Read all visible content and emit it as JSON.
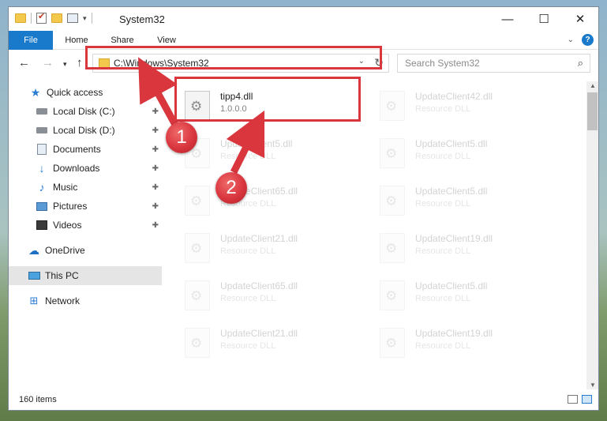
{
  "window": {
    "title": "System32",
    "controls": {
      "minimize": "—",
      "maximize": "☐",
      "close": "✕"
    }
  },
  "ribbon": {
    "tabs": [
      "File",
      "Home",
      "Share",
      "View"
    ],
    "help": "?"
  },
  "navbar": {
    "address": "C:\\Windows\\System32",
    "search_placeholder": "Search System32"
  },
  "sidebar": {
    "items": [
      {
        "label": "Quick access",
        "icon": "star-icon"
      },
      {
        "label": "Local Disk (C:)",
        "icon": "drive-icon",
        "pinned": true
      },
      {
        "label": "Local Disk (D:)",
        "icon": "drive-icon",
        "pinned": true
      },
      {
        "label": "Documents",
        "icon": "documents-icon",
        "pinned": true
      },
      {
        "label": "Downloads",
        "icon": "download-icon",
        "pinned": true
      },
      {
        "label": "Music",
        "icon": "music-icon",
        "pinned": true
      },
      {
        "label": "Pictures",
        "icon": "pictures-icon",
        "pinned": true
      },
      {
        "label": "Videos",
        "icon": "videos-icon",
        "pinned": true
      },
      {
        "label": "OneDrive",
        "icon": "cloud-icon"
      },
      {
        "label": "This PC",
        "icon": "computer-icon",
        "selected": true
      },
      {
        "label": "Network",
        "icon": "network-icon"
      }
    ]
  },
  "files": [
    {
      "name": "tipp4.dll",
      "subtitle": "1.0.0.0"
    },
    {
      "name": "UpdateClient42.dll",
      "subtitle": "Resource DLL"
    },
    {
      "name": "UpdateClient5.dll",
      "subtitle": "Resource DLL"
    },
    {
      "name": "UpdateClient5.dll",
      "subtitle": "Resource DLL"
    },
    {
      "name": "UpdateClient65.dll",
      "subtitle": "Resource DLL"
    },
    {
      "name": "UpdateClient5.dll",
      "subtitle": "Resource DLL"
    },
    {
      "name": "UpdateClient21.dll",
      "subtitle": "Resource DLL"
    },
    {
      "name": "UpdateClient19.dll",
      "subtitle": "Resource DLL"
    },
    {
      "name": "UpdateClient65.dll",
      "subtitle": "Resource DLL"
    },
    {
      "name": "UpdateClient5.dll",
      "subtitle": "Resource DLL"
    },
    {
      "name": "UpdateClient21.dll",
      "subtitle": "Resource DLL"
    },
    {
      "name": "UpdateClient19.dll",
      "subtitle": "Resource DLL"
    }
  ],
  "status": {
    "item_count": "160 items"
  },
  "annotations": {
    "badge1": "1",
    "badge2": "2",
    "color": "#d9363e"
  },
  "colors": {
    "accent": "#1979ca",
    "highlight": "#d9363e"
  }
}
